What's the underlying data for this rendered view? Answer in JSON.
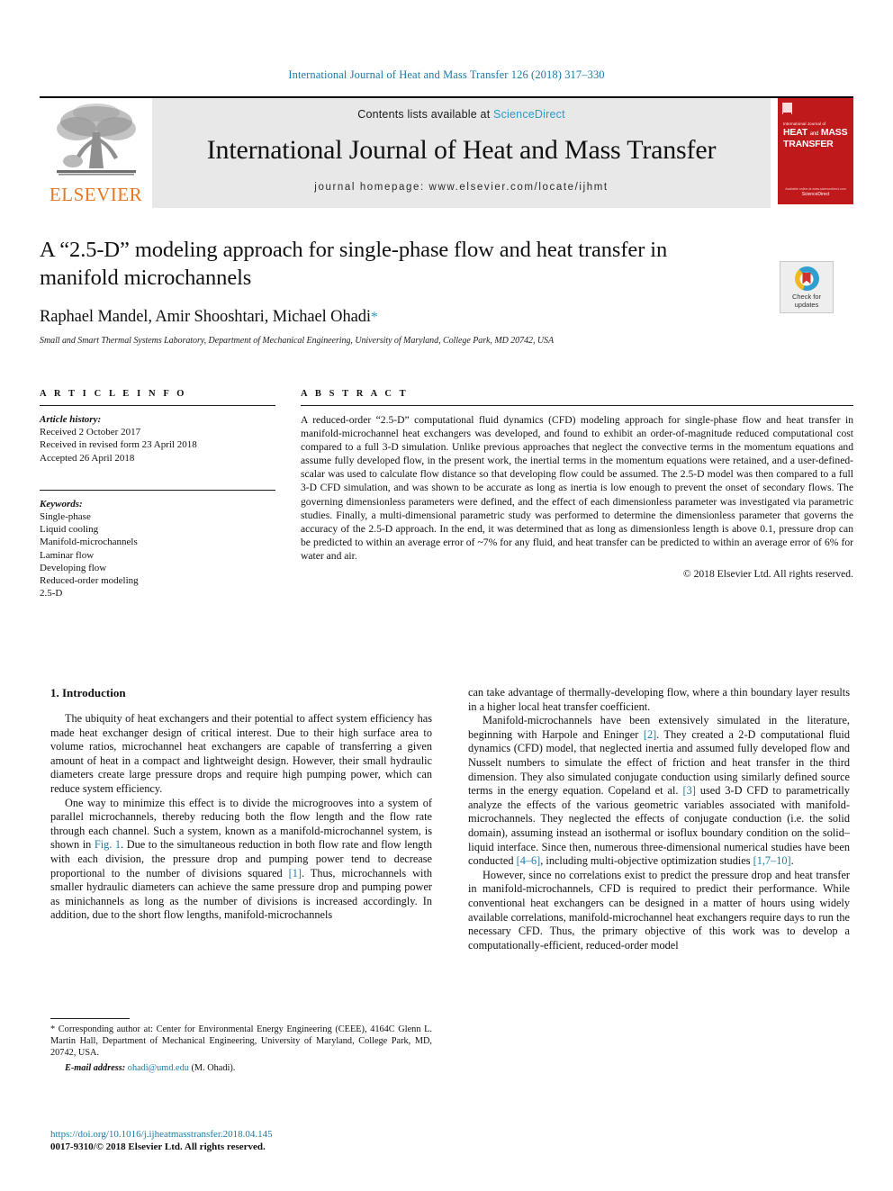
{
  "running_head": "International Journal of Heat and Mass Transfer 126 (2018) 317–330",
  "masthead": {
    "publisher_logo_text": "ELSEVIER",
    "contents_prefix": "Contents lists available at ",
    "contents_link": "ScienceDirect",
    "journal_title": "International Journal of Heat and Mass Transfer",
    "homepage": "journal homepage: www.elsevier.com/locate/ijhmt",
    "cover": {
      "supra": "International Journal of",
      "line1": "HEAT",
      "line1_small": "and",
      "line1b": "MASS",
      "line2": "TRANSFER",
      "foot_small": "Available online at www.sciencedirect.com",
      "foot_bold": "ScienceDirect"
    }
  },
  "article": {
    "title": "A “2.5-D” modeling approach for single-phase flow and heat transfer in manifold microchannels",
    "authors": "Raphael Mandel, Amir Shooshtari, Michael Ohadi",
    "corresponding_marker": "*",
    "affiliation": "Small and Smart Thermal Systems Laboratory, Department of Mechanical Engineering, University of Maryland, College Park, MD 20742, USA",
    "crossmark_label_line1": "Check for",
    "crossmark_label_line2": "updates"
  },
  "article_info": {
    "heading": "A R T I C L E   I N F O",
    "history_label": "Article history:",
    "history": [
      "Received 2 October 2017",
      "Received in revised form 23 April 2018",
      "Accepted 26 April 2018"
    ],
    "keywords_label": "Keywords:",
    "keywords": [
      "Single-phase",
      "Liquid cooling",
      "Manifold-microchannels",
      "Laminar flow",
      "Developing flow",
      "Reduced-order modeling",
      "2.5-D"
    ]
  },
  "abstract": {
    "heading": "A B S T R A C T",
    "text": "A reduced-order “2.5-D” computational fluid dynamics (CFD) modeling approach for single-phase flow and heat transfer in manifold-microchannel heat exchangers was developed, and found to exhibit an order-of-magnitude reduced computational cost compared to a full 3-D simulation. Unlike previous approaches that neglect the convective terms in the momentum equations and assume fully developed flow, in the present work, the inertial terms in the momentum equations were retained, and a user-defined-scalar was used to calculate flow distance so that developing flow could be assumed. The 2.5-D model was then compared to a full 3-D CFD simulation, and was shown to be accurate as long as inertia is low enough to prevent the onset of secondary flows. The governing dimensionless parameters were defined, and the effect of each dimensionless parameter was investigated via parametric studies. Finally, a multi-dimensional parametric study was performed to determine the dimensionless parameter that governs the accuracy of the 2.5-D approach. In the end, it was determined that as long as dimensionless length is above 0.1, pressure drop can be predicted to within an average error of ~7% for any fluid, and heat transfer can be predicted to within an average error of 6% for water and air.",
    "copyright": "© 2018 Elsevier Ltd. All rights reserved."
  },
  "body": {
    "section_heading": "1. Introduction",
    "left_paragraphs": [
      "The ubiquity of heat exchangers and their potential to affect system efficiency has made heat exchanger design of critical interest. Due to their high surface area to volume ratios, microchannel heat exchangers are capable of transferring a given amount of heat in a compact and lightweight design. However, their small hydraulic diameters create large pressure drops and require high pumping power, which can reduce system efficiency."
    ],
    "left_para2_a": "One way to minimize this effect is to divide the microgrooves into a system of parallel microchannels, thereby reducing both the flow length and the flow rate through each channel. Such a system, known as a manifold-microchannel system, is shown in ",
    "left_para2_fig": "Fig. 1",
    "left_para2_b": ". Due to the simultaneous reduction in both flow rate and flow length with each division, the pressure drop and pumping power tend to decrease proportional to the number of divisions squared ",
    "left_para2_ref": "[1]",
    "left_para2_c": ". Thus, microchannels with smaller hydraulic diameters can achieve the same pressure drop and pumping power as minichannels as long as the number of divisions is increased accordingly. In addition, due to the short flow lengths, manifold-microchannels",
    "right_para1": "can take advantage of thermally-developing flow, where a thin boundary layer results in a higher local heat transfer coefficient.",
    "right_para2_a": "Manifold-microchannels have been extensively simulated in the literature, beginning with Harpole and Eninger ",
    "right_para2_ref1": "[2]",
    "right_para2_b": ". They created a 2-D computational fluid dynamics (CFD) model, that neglected inertia and assumed fully developed flow and Nusselt numbers to simulate the effect of friction and heat transfer in the third dimension. They also simulated conjugate conduction using similarly defined source terms in the energy equation. Copeland et al. ",
    "right_para2_ref2": "[3]",
    "right_para2_c": " used 3-D CFD to parametrically analyze the effects of the various geometric variables associated with manifold-microchannels. They neglected the effects of conjugate conduction (i.e. the solid domain), assuming instead an isothermal or isoflux boundary condition on the solid–liquid interface. Since then, numerous three-dimensional numerical studies have been conducted ",
    "right_para2_ref3": "[4–6]",
    "right_para2_d": ", including multi-objective optimization studies ",
    "right_para2_ref4": "[1,7–10]",
    "right_para2_e": ".",
    "right_para3": "However, since no correlations exist to predict the pressure drop and heat transfer in manifold-microchannels, CFD is required to predict their performance. While conventional heat exchangers can be designed in a matter of hours using widely available correlations, manifold-microchannel heat exchangers require days to run the necessary CFD. Thus, the primary objective of this work was to develop a computationally-efficient, reduced-order model"
  },
  "footnote": {
    "marker": "*",
    "text": " Corresponding author at: Center for Environmental Energy Engineering (CEEE), 4164C Glenn L. Martin Hall, Department of Mechanical Engineering, University of Maryland, College Park, MD, 20742, USA.",
    "email_label": "E-mail address:",
    "email": "ohadi@umd.edu",
    "email_suffix": " (M. Ohadi)."
  },
  "page_footer": {
    "doi": "https://doi.org/10.1016/j.ijheatmasstransfer.2018.04.145",
    "issn_line": "0017-9310/© 2018 Elsevier Ltd. All rights reserved."
  },
  "colors": {
    "link": "#1a7ba8",
    "sciencedirect": "#2a9cc8",
    "elsevier_orange": "#E87722",
    "cover_red": "#c0191c"
  }
}
